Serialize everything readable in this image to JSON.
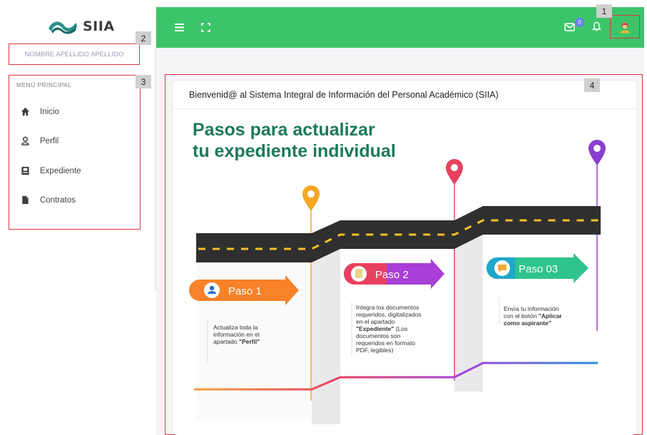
{
  "logo": {
    "text": "SIIA"
  },
  "user": {
    "name": "NOMBRE APELLIDO APELLIDO"
  },
  "menu": {
    "title": "MENÚ PRINCIPAL",
    "items": [
      {
        "label": "Inicio",
        "icon": "home-icon"
      },
      {
        "label": "Perfil",
        "icon": "user-icon"
      },
      {
        "label": "Expediente",
        "icon": "id-card-icon"
      },
      {
        "label": "Contratos",
        "icon": "file-icon"
      }
    ]
  },
  "topbar": {
    "color": "#3cc46a",
    "notification_count": "0",
    "icons": [
      "hamburger-icon",
      "fullscreen-icon",
      "mail-icon",
      "bell-icon",
      "avatar"
    ]
  },
  "annotations": {
    "a1": "1",
    "a2": "2",
    "a3": "3",
    "a4": "4"
  },
  "card": {
    "title": "Bienvenid@ al Sistema Integral de Información del Personal Académico (SIIA)"
  },
  "infographic": {
    "heading_line1": "Pasos para actualizar",
    "heading_line2": "tu expediente individual",
    "steps": [
      {
        "label": "Paso 1",
        "text": [
          "Actualiza toda la",
          "información en el",
          "apartado "
        ],
        "bold": "\"Perfil\""
      },
      {
        "label": "Paso 2",
        "text": [
          "Integra los documentos",
          "requeridos, digitalizados",
          "en el apartado"
        ],
        "bold": "\"Expediente\"",
        "text2": [
          " (Los",
          "documentos son",
          "requeridos en formato",
          "PDF, legibles)"
        ]
      },
      {
        "label": "Paso 03",
        "text": [
          "Envía tu información",
          "con el botón "
        ],
        "bold": "\"Aplicar",
        "bold2": "como aspirante\""
      }
    ]
  }
}
